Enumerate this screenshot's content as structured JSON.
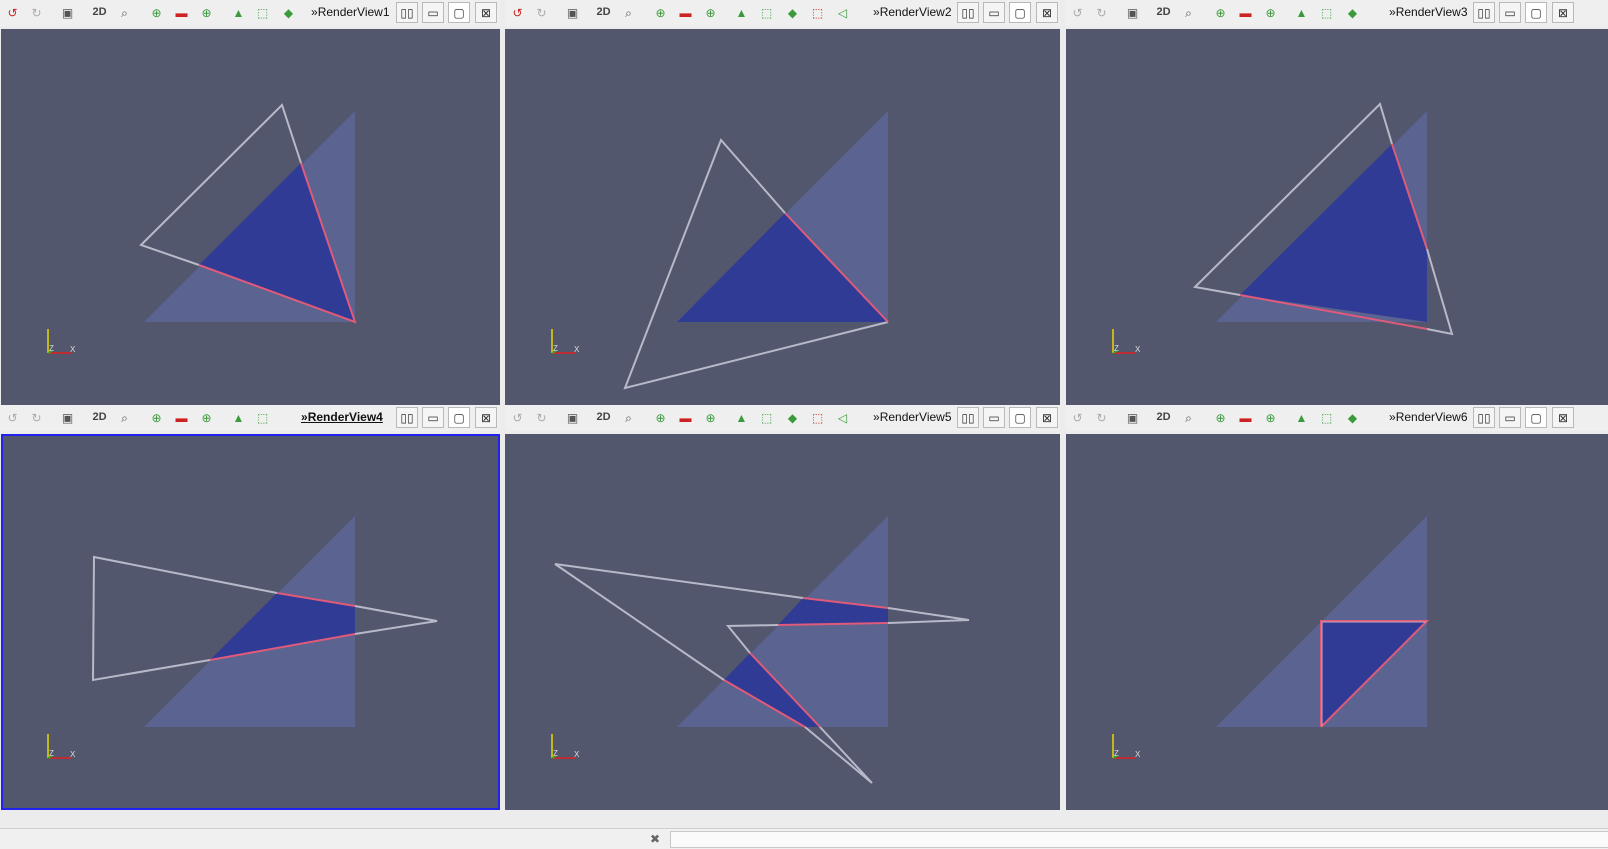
{
  "toolbar": {
    "icons": {
      "reset_camera": "↺",
      "redo_camera": "↻",
      "capture": "▣",
      "mode_2d": "2D",
      "zoom_box": "⌕",
      "pick_center": "⊕",
      "hide_center": "▬",
      "reset_center": "⊕",
      "select_cells": "▲",
      "select_points": "⬚",
      "select_block": "◆",
      "frustum_select": "⬚",
      "interactive_select": "◁",
      "split_h": "▯▯",
      "split_v": "▭",
      "maximize": "▢",
      "close": "⊠"
    }
  },
  "views": [
    {
      "title": "RenderView1",
      "prefix": "»",
      "active": false
    },
    {
      "title": "RenderView2",
      "prefix": "»",
      "active": false
    },
    {
      "title": "RenderView3",
      "prefix": "»",
      "active": false
    },
    {
      "title": "RenderView4",
      "prefix": "»",
      "active": true
    },
    {
      "title": "RenderView5",
      "prefix": "»",
      "active": false
    },
    {
      "title": "RenderView6",
      "prefix": "»",
      "active": false
    }
  ],
  "axes": {
    "z": "Z",
    "x": "X"
  },
  "colors": {
    "view_bg": "#52576e",
    "plane": "#5b6391",
    "fill": "#2f3b95",
    "outline": "#b8b9c8",
    "clip_edge": "#e05a7a"
  },
  "statusbar": {
    "close_icon": "✖"
  }
}
